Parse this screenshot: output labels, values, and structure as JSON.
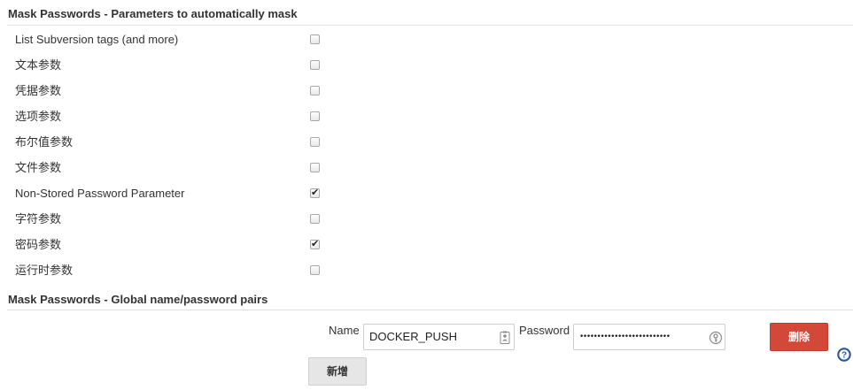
{
  "section_params": {
    "title": "Mask Passwords - Parameters to automatically mask"
  },
  "params": [
    {
      "label": "List Subversion tags (and more)",
      "checked": false
    },
    {
      "label": "文本参数",
      "checked": false
    },
    {
      "label": "凭据参数",
      "checked": false
    },
    {
      "label": "选项参数",
      "checked": false
    },
    {
      "label": "布尔值参数",
      "checked": false
    },
    {
      "label": "文件参数",
      "checked": false
    },
    {
      "label": "Non-Stored Password Parameter",
      "checked": true
    },
    {
      "label": "字符参数",
      "checked": false
    },
    {
      "label": "密码参数",
      "checked": true
    },
    {
      "label": "运行时参数",
      "checked": false
    }
  ],
  "section_pairs": {
    "title": "Mask Passwords - Global name/password pairs"
  },
  "pair": {
    "name_label": "Name",
    "name_value": "DOCKER_PUSH",
    "password_label": "Password",
    "password_mask": "••••••••••••••••••••••••••"
  },
  "buttons": {
    "delete_label": "删除",
    "add_label": "新增"
  },
  "colors": {
    "delete_button": "#d24939",
    "help_icon": "#2a5fa8"
  },
  "icons": {
    "name_field": "contact-card-icon",
    "password_field": "key-icon",
    "help": "help-icon"
  }
}
